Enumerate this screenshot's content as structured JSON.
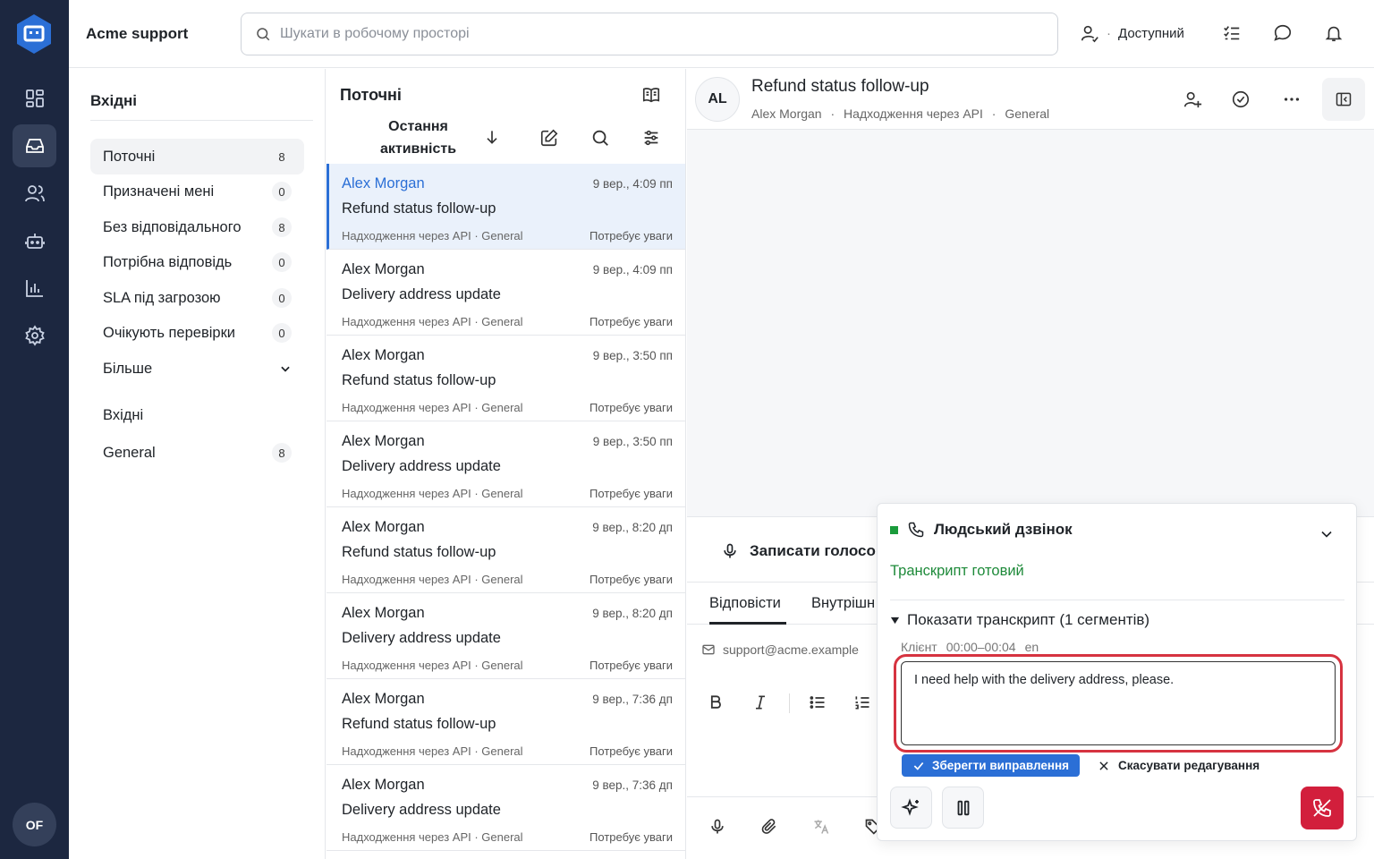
{
  "app": {
    "brand": "Acme support",
    "user_initials": "OF"
  },
  "rail": {
    "items": [
      "dashboard-icon",
      "inbox-icon",
      "contacts-icon",
      "bot-icon",
      "reports-icon",
      "settings-icon"
    ]
  },
  "topbar": {
    "search_placeholder": "Шукати в робочому просторі",
    "status_separator": "·",
    "status_label": "Доступний"
  },
  "sidebar": {
    "title": "Вхідні",
    "items": [
      {
        "label": "Поточні",
        "count": "8"
      },
      {
        "label": "Призначені мені",
        "count": "0"
      },
      {
        "label": "Без відповідального",
        "count": "8"
      },
      {
        "label": "Потрібна відповідь",
        "count": "0"
      },
      {
        "label": "SLA під загрозою",
        "count": "0"
      },
      {
        "label": "Очікують перевірки",
        "count": "0"
      },
      {
        "label": "Більше",
        "count": ""
      }
    ],
    "group_title": "Вхідні",
    "group_items": [
      {
        "label": "General",
        "count": "8"
      }
    ]
  },
  "list": {
    "title": "Поточні",
    "sort_label_1": "Остання",
    "sort_label_2": "активність",
    "conversations": [
      {
        "name": "Alex Morgan",
        "time": "9 вер., 4:09 пп",
        "subject": "Refund status follow-up",
        "meta": "Надходження через API · General",
        "status": "Потребує уваги"
      },
      {
        "name": "Alex Morgan",
        "time": "9 вер., 4:09 пп",
        "subject": "Delivery address update",
        "meta": "Надходження через API · General",
        "status": "Потребує уваги"
      },
      {
        "name": "Alex Morgan",
        "time": "9 вер., 3:50 пп",
        "subject": "Refund status follow-up",
        "meta": "Надходження через API · General",
        "status": "Потребує уваги"
      },
      {
        "name": "Alex Morgan",
        "time": "9 вер., 3:50 пп",
        "subject": "Delivery address update",
        "meta": "Надходження через API · General",
        "status": "Потребує уваги"
      },
      {
        "name": "Alex Morgan",
        "time": "9 вер., 8:20 дп",
        "subject": "Refund status follow-up",
        "meta": "Надходження через API · General",
        "status": "Потребує уваги"
      },
      {
        "name": "Alex Morgan",
        "time": "9 вер., 8:20 дп",
        "subject": "Delivery address update",
        "meta": "Надходження через API · General",
        "status": "Потребує уваги"
      },
      {
        "name": "Alex Morgan",
        "time": "9 вер., 7:36 дп",
        "subject": "Refund status follow-up",
        "meta": "Надходження через API · General",
        "status": "Потребує уваги"
      },
      {
        "name": "Alex Morgan",
        "time": "9 вер., 7:36 дп",
        "subject": "Delivery address update",
        "meta": "Надходження через API · General",
        "status": "Потребує уваги"
      }
    ]
  },
  "conversation": {
    "avatar": "AL",
    "title": "Refund status follow-up",
    "contact": "Alex Morgan",
    "sep": "·",
    "source": "Надходження через API",
    "inbox": "General"
  },
  "composer": {
    "record_label": "Записати голосов",
    "tab_reply": "Відповісти",
    "tab_internal": "Внутрішн",
    "from_email": "support@acme.example"
  },
  "call": {
    "title": "Людський дзвінок",
    "transcript_status": "Транскрипт готовий",
    "show_transcript": "Показати транскрипт (1 сегментів)",
    "segment_speaker": "Клієнт",
    "segment_time": "00:00–00:04",
    "segment_lang": "en",
    "segment_text": "I need help with the delivery address, please.",
    "save_label": "Зберегти виправлення",
    "cancel_label": "Скасувати редагування"
  },
  "colors": {
    "rail": "#1c2740",
    "accent": "#2b6fd6",
    "success": "#1e8a3a",
    "danger": "#d21f3c"
  }
}
